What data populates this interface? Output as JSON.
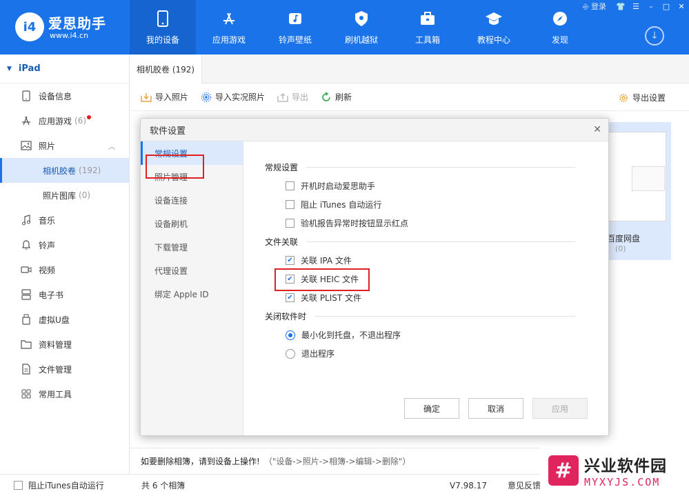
{
  "app": {
    "brand": "爱思助手",
    "url": "www.i4.cn",
    "logo_text": "i4"
  },
  "window": {
    "login": "登录"
  },
  "nav": [
    {
      "label": "我的设备",
      "icon": "phone-icon"
    },
    {
      "label": "应用游戏",
      "icon": "appstore-icon"
    },
    {
      "label": "铃声壁纸",
      "icon": "music-icon"
    },
    {
      "label": "刷机越狱",
      "icon": "shield-icon"
    },
    {
      "label": "工具箱",
      "icon": "toolbox-icon"
    },
    {
      "label": "教程中心",
      "icon": "graduation-cap-icon"
    },
    {
      "label": "发现",
      "icon": "compass-icon"
    }
  ],
  "sidebar": {
    "device": "iPad",
    "items": [
      {
        "label": "设备信息",
        "icon": "tablet-icon",
        "count": ""
      },
      {
        "label": "应用游戏",
        "icon": "appstore-icon",
        "count": "(6)"
      },
      {
        "label": "照片",
        "icon": "photo-icon",
        "count": ""
      },
      {
        "label": "相机胶卷",
        "icon": "",
        "count": "(192)"
      },
      {
        "label": "照片图库",
        "icon": "",
        "count": "(0)"
      },
      {
        "label": "音乐",
        "icon": "music-note-icon",
        "count": ""
      },
      {
        "label": "铃声",
        "icon": "bell-icon",
        "count": ""
      },
      {
        "label": "视频",
        "icon": "video-icon",
        "count": ""
      },
      {
        "label": "电子书",
        "icon": "book-icon",
        "count": ""
      },
      {
        "label": "虚拟U盘",
        "icon": "usb-icon",
        "count": ""
      },
      {
        "label": "资料管理",
        "icon": "folder-icon",
        "count": ""
      },
      {
        "label": "文件管理",
        "icon": "file-icon",
        "count": ""
      },
      {
        "label": "常用工具",
        "icon": "grid-icon",
        "count": ""
      }
    ]
  },
  "main": {
    "tab": "相机胶卷 (192)",
    "toolbar": {
      "import_photos": "导入照片",
      "import_live": "导入实况照片",
      "export": "导出",
      "refresh": "刷新",
      "export_settings": "导出设置"
    },
    "album": {
      "name": "百度网盘",
      "count": "(0)"
    },
    "hint": "如要删除相簿，请到设备上操作!",
    "hint_path": "（\"设备->照片->相簿->编辑->删除\"）"
  },
  "statusbar": {
    "block_itunes": "阻止iTunes自动运行",
    "albums": "共 6 个相簿",
    "version": "V7.98.17",
    "feedback": "意见反馈"
  },
  "watermark": {
    "line1": "兴业软件园",
    "line2": "MYXYJS.COM",
    "logo": "#"
  },
  "dialog": {
    "title": "软件设置",
    "nav": [
      "常规设置",
      "照片管理",
      "设备连接",
      "设备刷机",
      "下载管理",
      "代理设置",
      "绑定 Apple ID"
    ],
    "sections": {
      "general": {
        "title": "常规设置",
        "options": [
          "开机时启动爱思助手",
          "阻止 iTunes 自动运行",
          "验机报告异常时按钮显示红点"
        ],
        "checked": [
          false,
          false,
          false
        ]
      },
      "files": {
        "title": "文件关联",
        "options": [
          "关联 IPA 文件",
          "关联 HEIC 文件",
          "关联 PLIST 文件"
        ],
        "checked": [
          true,
          true,
          true
        ]
      },
      "close": {
        "title": "关闭软件时",
        "options": [
          "最小化到托盘，不退出程序",
          "退出程序"
        ],
        "selected": 0
      }
    },
    "buttons": {
      "ok": "确定",
      "cancel": "取消",
      "apply": "应用"
    }
  },
  "colors": {
    "accent": "#1a73e8",
    "highlight": "#e02020"
  }
}
